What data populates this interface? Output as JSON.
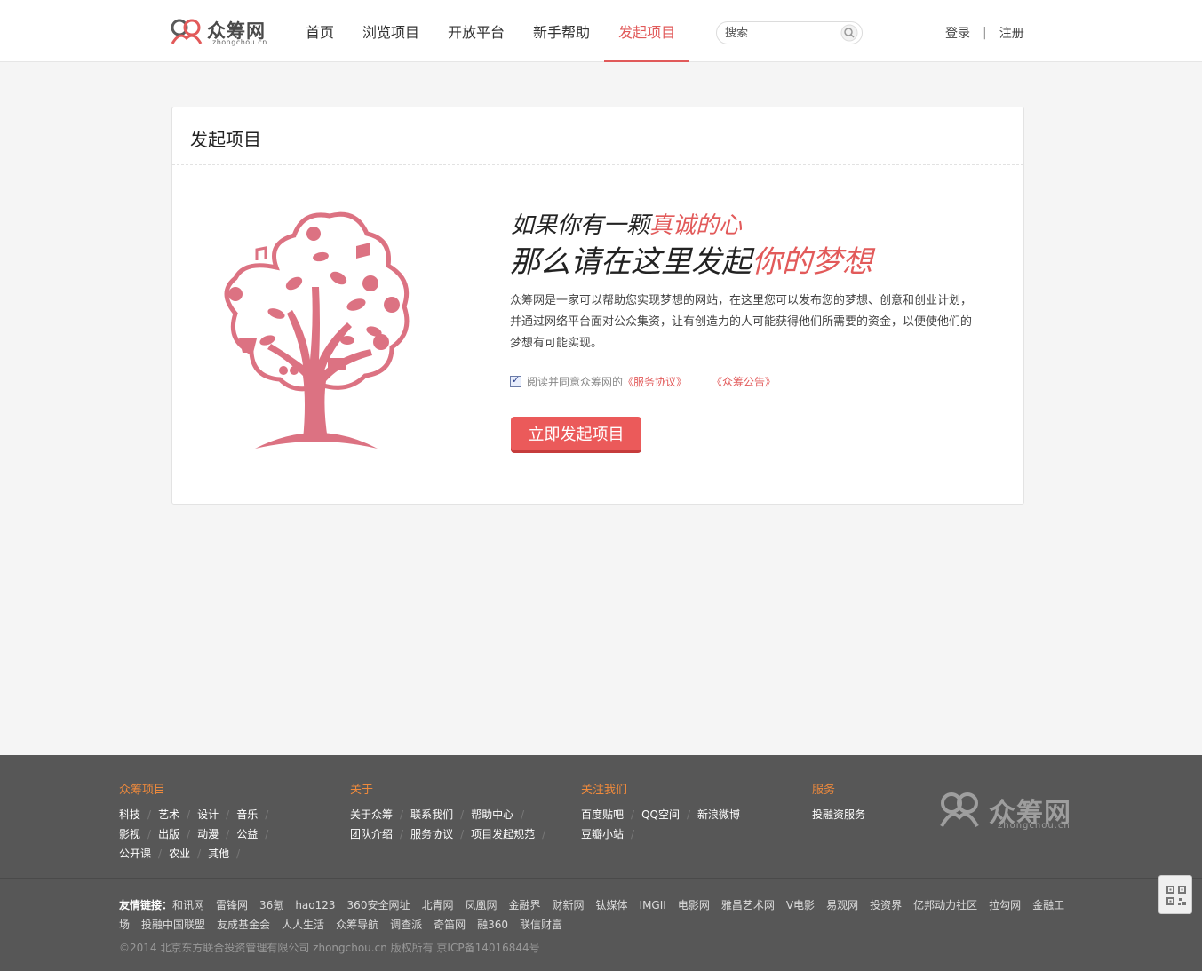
{
  "header": {
    "logo_text": "众筹网",
    "logo_sub": "zhongchou.cn",
    "nav": [
      {
        "label": "首页"
      },
      {
        "label": "浏览项目"
      },
      {
        "label": "开放平台"
      },
      {
        "label": "新手帮助"
      },
      {
        "label": "发起项目",
        "active": true
      }
    ],
    "search_placeholder": "搜索",
    "login": "登录",
    "register": "注册"
  },
  "card": {
    "title": "发起项目",
    "slogan1_a": "如果你有一颗",
    "slogan1_b": "真诚的心",
    "slogan2_a": "那么请在这里发起",
    "slogan2_b": "你的梦想",
    "description": "众筹网是一家可以帮助您实现梦想的网站，在这里您可以发布您的梦想、创意和创业计划，并通过网络平台面对公众集资，让有创造力的人可能获得他们所需要的资金，以便使他们的梦想有可能实现。",
    "agree_text": "阅读并同意众筹网的",
    "agree_link1": "《服务协议》",
    "agree_link2": "《众筹公告》",
    "agree_checked": true,
    "start_button": "立即发起项目"
  },
  "footer": {
    "columns": [
      {
        "title": "众筹项目",
        "rows": [
          [
            "科技",
            "艺术",
            "设计",
            "音乐"
          ],
          [
            "影视",
            "出版",
            "动漫",
            "公益"
          ],
          [
            "公开课",
            "农业",
            "其他"
          ]
        ]
      },
      {
        "title": "关于",
        "rows": [
          [
            "关于众筹",
            "联系我们",
            "帮助中心"
          ],
          [
            "团队介绍",
            "服务协议",
            "项目发起规范"
          ]
        ]
      },
      {
        "title": "关注我们",
        "rows": [
          [
            "百度贴吧",
            "QQ空间",
            "新浪微博"
          ],
          [
            "豆瓣小站"
          ]
        ]
      },
      {
        "title": "服务",
        "rows": [
          [
            "投融资服务"
          ]
        ]
      }
    ],
    "logo_text": "众筹网",
    "logo_sub": "zhongchou.cn",
    "friend_label": "友情链接：",
    "friend_links": [
      "和讯网",
      "雷锋网",
      "36氪",
      "hao123",
      "360安全网址",
      "北青网",
      "凤凰网",
      "金融界",
      "财新网",
      "钛媒体",
      "IMGII",
      "电影网",
      "雅昌艺术网",
      "V电影",
      "易观网",
      "投资界",
      "亿邦动力社区",
      "拉勾网",
      "金融工场",
      "投融中国联盟",
      "友成基金会",
      "人人生活",
      "众筹导航",
      "调查派",
      "奇笛网",
      "融360",
      "联信财富"
    ],
    "copyright": "©2014 北京东方联合投资管理有限公司 zhongchou.cn 版权所有 京ICP备14016844号"
  },
  "colors": {
    "accent": "#e25a5a",
    "footer_bg": "#575757",
    "footer_heading": "#ef8a3c",
    "tree": "#dc7282"
  }
}
